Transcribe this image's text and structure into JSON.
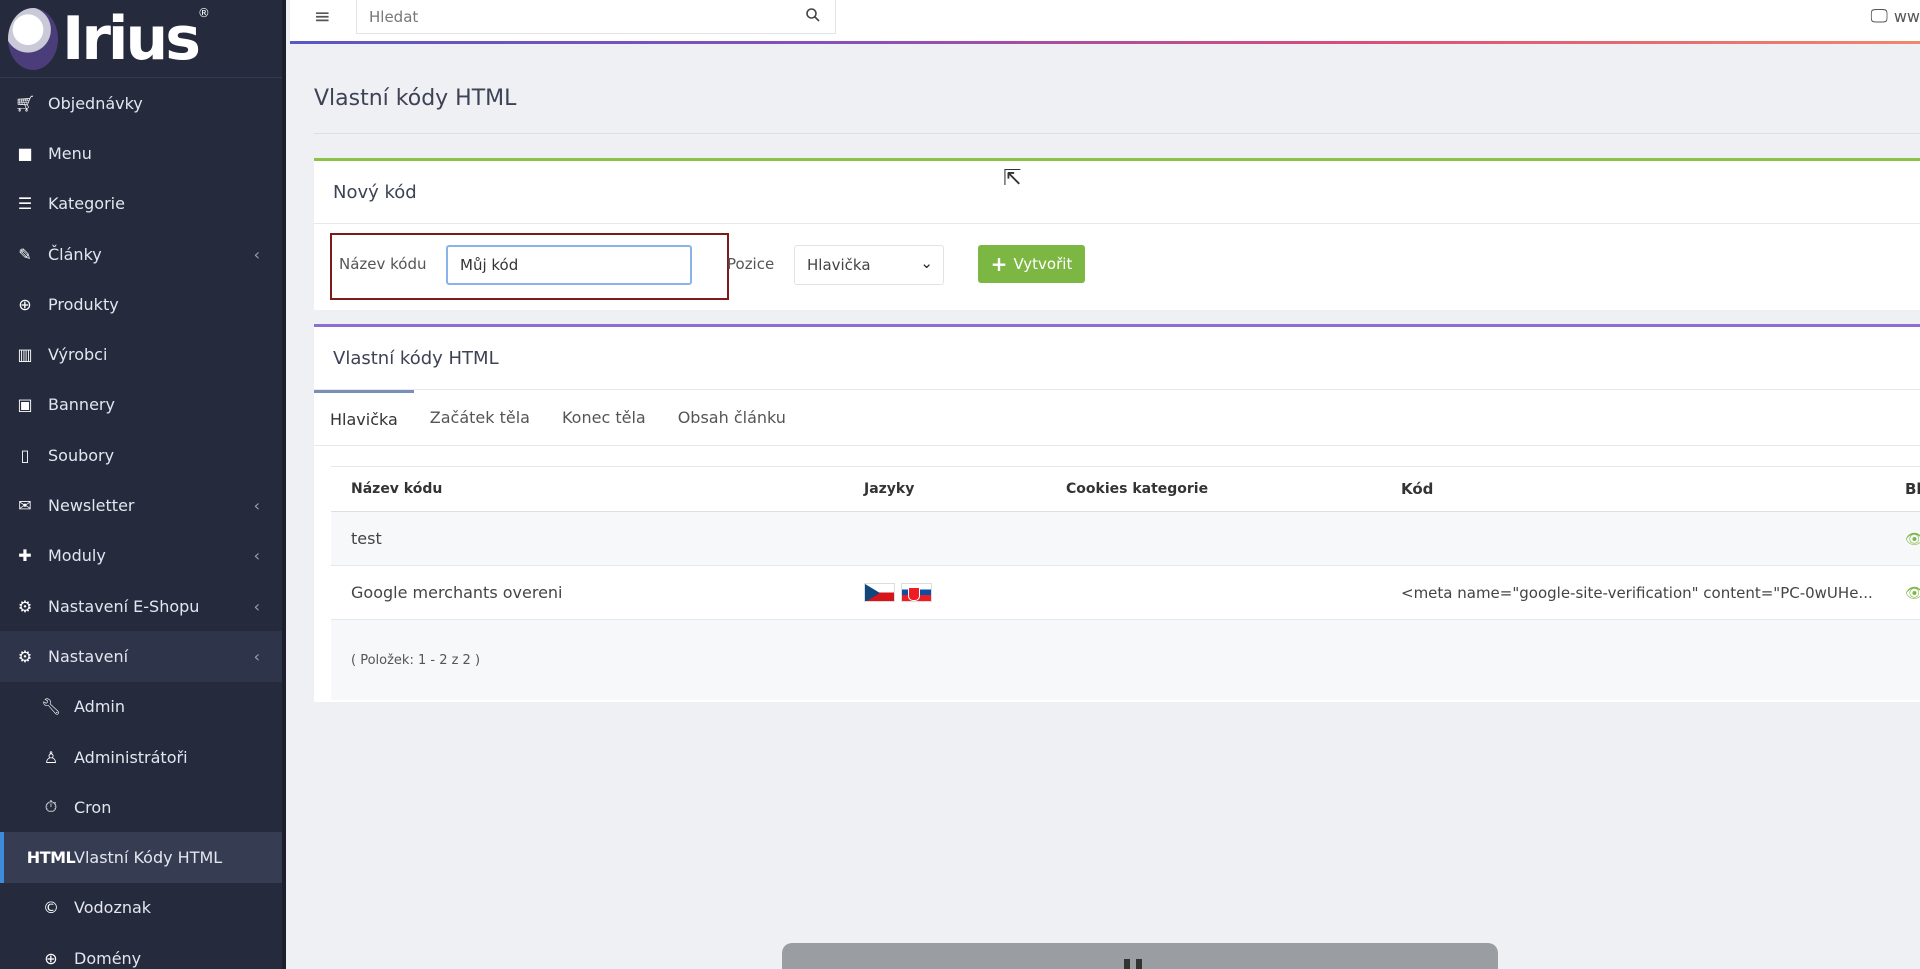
{
  "sidebar": {
    "logo_text": "Irius",
    "items": [
      {
        "label": "Objednávky",
        "icon": "cart-icon"
      },
      {
        "label": "Menu",
        "icon": "folder-icon"
      },
      {
        "label": "Kategorie",
        "icon": "list-icon"
      },
      {
        "label": "Články",
        "icon": "pencil-icon",
        "has_children": true
      },
      {
        "label": "Produkty",
        "icon": "globe-icon"
      },
      {
        "label": "Výrobci",
        "icon": "building-icon"
      },
      {
        "label": "Bannery",
        "icon": "image-icon"
      },
      {
        "label": "Soubory",
        "icon": "file-icon"
      },
      {
        "label": "Newsletter",
        "icon": "envelope-icon",
        "has_children": true
      },
      {
        "label": "Moduly",
        "icon": "puzzle-icon",
        "has_children": true
      },
      {
        "label": "Nastavení E-Shopu",
        "icon": "cogs-icon",
        "has_children": true
      },
      {
        "label": "Nastavení",
        "icon": "cogs-icon",
        "has_children": true,
        "expanded": true
      }
    ],
    "sub_items": [
      {
        "label": "Admin",
        "icon": "wrench-icon"
      },
      {
        "label": "Administrátoři",
        "icon": "user-icon"
      },
      {
        "label": "Cron",
        "icon": "stopwatch-icon"
      },
      {
        "label": "Vlastní Kódy HTML",
        "icon": "html-icon",
        "current": true
      },
      {
        "label": "Vodoznak",
        "icon": "copyright-icon"
      },
      {
        "label": "Domény",
        "icon": "globe-icon"
      }
    ]
  },
  "header": {
    "search_placeholder": "Hledat",
    "site_label": "ww"
  },
  "page": {
    "title": "Vlastní kódy HTML"
  },
  "new_code": {
    "title": "Nový kód",
    "name_label": "Název kódu",
    "name_value": "Můj kód",
    "position_label": "Pozice",
    "position_value": "Hlavička",
    "create_label": "Vytvořit"
  },
  "codes": {
    "title": "Vlastní kódy HTML",
    "tabs": [
      "Hlavička",
      "Začátek těla",
      "Konec těla",
      "Obsah článku"
    ],
    "active_tab": 0,
    "columns": [
      "Název kódu",
      "Jazyky",
      "Cookies kategorie",
      "Kód",
      "Bl"
    ],
    "rows": [
      {
        "name": "test",
        "languages": [],
        "cookies": "",
        "code": ""
      },
      {
        "name": "Google merchants overeni",
        "languages": [
          "cz",
          "sk"
        ],
        "cookies": "",
        "code": "<meta name=\"google-site-verification\" content=\"PC-0wUHe..."
      }
    ],
    "footer": "( Položek: 1 - 2 z 2 )"
  }
}
